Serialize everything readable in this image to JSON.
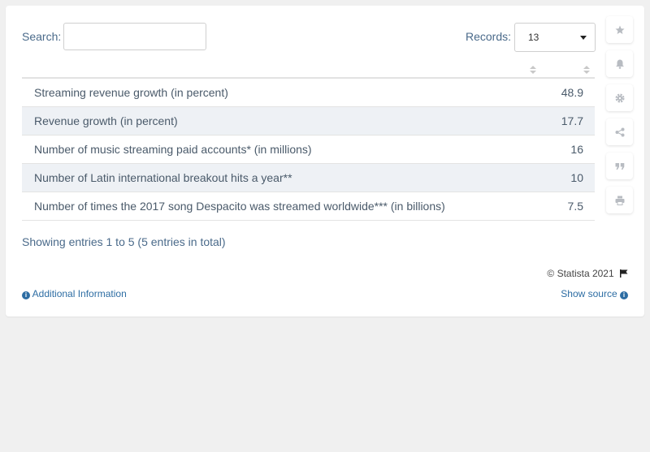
{
  "search": {
    "label": "Search:",
    "value": ""
  },
  "records": {
    "label": "Records:",
    "selected": "13"
  },
  "table": {
    "rows": [
      {
        "label": "Streaming revenue growth (in percent)",
        "value": "48.9"
      },
      {
        "label": "Revenue growth (in percent)",
        "value": "17.7"
      },
      {
        "label": "Number of music streaming paid accounts* (in millions)",
        "value": "16"
      },
      {
        "label": "Number of Latin international breakout hits a year**",
        "value": "10"
      },
      {
        "label": "Number of times the 2017 song Despacito was streamed worldwide*** (in billions)",
        "value": "7.5"
      }
    ]
  },
  "footer": {
    "showing": "Showing entries 1 to 5 (5 entries in total)",
    "copyright": "© Statista 2021",
    "additional_info": "Additional Information",
    "show_source": "Show source"
  },
  "sidebar": {
    "icons": [
      "star-icon",
      "bell-icon",
      "gear-icon",
      "share-icon",
      "quote-icon",
      "print-icon"
    ]
  },
  "colors": {
    "link": "#2d6da3",
    "label": "#4a6a8a",
    "row_alt": "#eef1f5",
    "icon_gray": "#b8bcc2"
  }
}
